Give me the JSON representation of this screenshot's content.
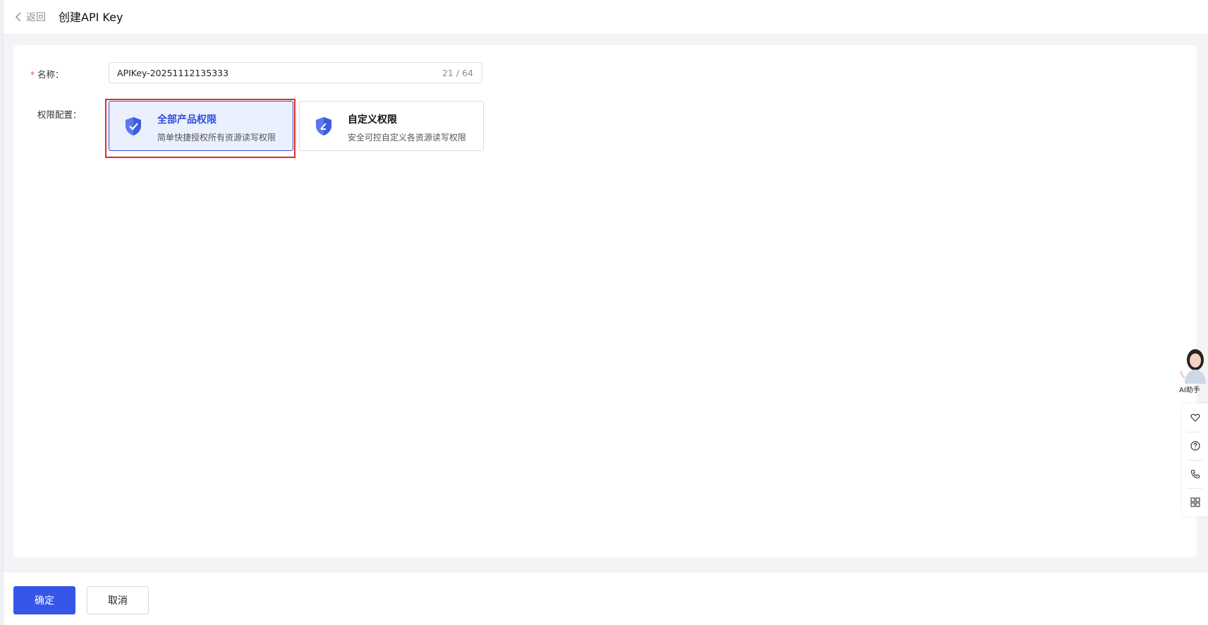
{
  "header": {
    "back_label": "返回",
    "title": "创建API Key"
  },
  "form": {
    "name_label": "名称：",
    "name_value": "APIKey-20251112135333",
    "name_counter": "21 / 64",
    "permission_label": "权限配置：",
    "options": [
      {
        "title": "全部产品权限",
        "desc": "简单快捷授权所有资源读写权限",
        "selected": true
      },
      {
        "title": "自定义权限",
        "desc": "安全可控自定义各资源读写权限",
        "selected": false
      }
    ]
  },
  "footer": {
    "confirm_label": "确定",
    "cancel_label": "取消"
  },
  "side": {
    "assistant_label": "AI助手",
    "toolbar_icons": [
      "heart-icon",
      "question-icon",
      "phone-icon",
      "apps-grid-icon"
    ]
  },
  "colors": {
    "accent": "#3656e8",
    "selected_bg": "#eaf0fd",
    "highlight": "#e02b2b",
    "required": "#e5484d"
  }
}
